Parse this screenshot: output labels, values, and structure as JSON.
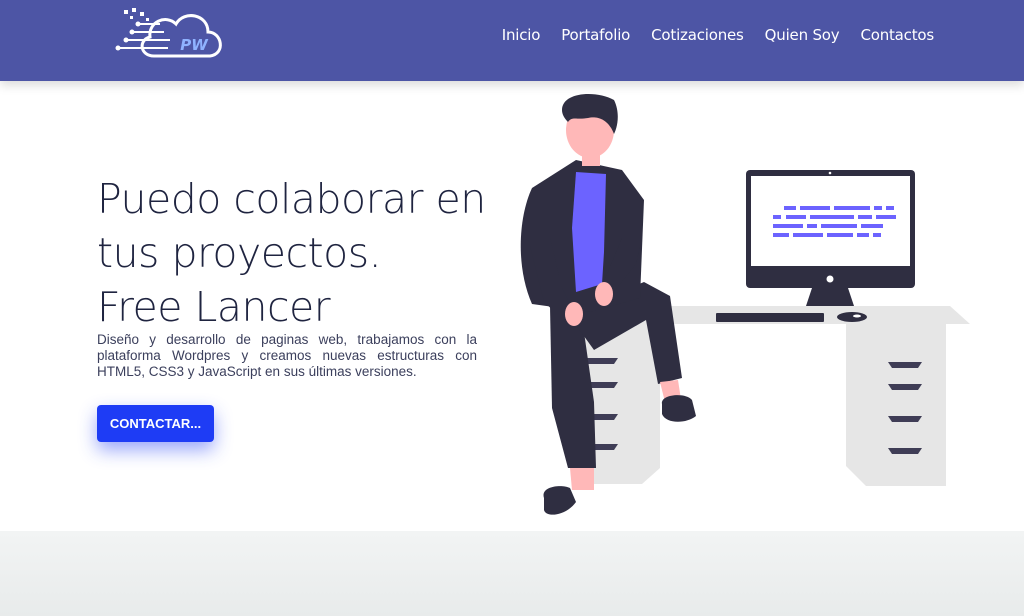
{
  "logo": {
    "icon": "cloud-circuit-logo",
    "text": "PW"
  },
  "nav": {
    "items": [
      {
        "label": "Inicio"
      },
      {
        "label": "Portafolio"
      },
      {
        "label": "Cotizaciones"
      },
      {
        "label": "Quien Soy"
      },
      {
        "label": "Contactos"
      }
    ]
  },
  "hero": {
    "title_line1": "Puedo colaborar en",
    "title_line2": "tus proyectos.",
    "title_line3": "Free Lancer",
    "description": "Diseño y desarrollo de paginas web, trabajamos con la plataforma Wordpres y creamos nuevas estructuras con HTML5, CSS3 y JavaScript en sus últimas versiones.",
    "cta_label": "CONTACTAR..."
  },
  "colors": {
    "navbar": "#4d55a5",
    "cta": "#1e3cf5",
    "accent_purple": "#6c63ff",
    "dark": "#2f2e41"
  }
}
